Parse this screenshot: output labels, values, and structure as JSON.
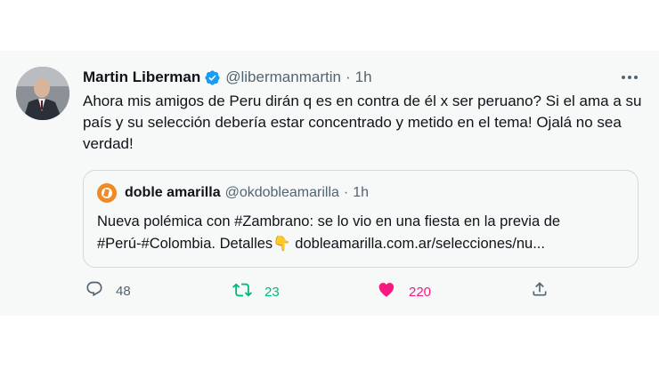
{
  "tweet": {
    "author_name": "Martin Liberman",
    "author_handle": "@libermanmartin",
    "separator": "·",
    "time": "1h",
    "text": "Ahora mis amigos de Peru dirán q es en contra de él x ser peruano? Si el ama a su país y su selección debería estar concentrado y metido en el tema! Ojalá no sea verdad!",
    "verified": true
  },
  "quoted_tweet": {
    "author_name": "doble amarilla",
    "author_handle": "@okdobleamarilla",
    "separator": "·",
    "time": "1h",
    "line1": "Nueva polémica con #Zambrano: se lo vio en una fiesta en la previa de",
    "line2": "#Perú-#Colombia. Detalles👇 doblеamarilla.com.ar/selecciones/nu..."
  },
  "actions": {
    "reply_count": "48",
    "retweet_count": "23",
    "like_count": "220"
  },
  "colors": {
    "verified": "#1d9bf0",
    "retweet": "#00ba7c",
    "like": "#f91880",
    "muted": "#536471",
    "background": "#f7f9f9"
  },
  "icons": [
    "verified-badge-icon",
    "more-icon",
    "reply-icon",
    "retweet-icon",
    "like-icon",
    "share-icon"
  ]
}
